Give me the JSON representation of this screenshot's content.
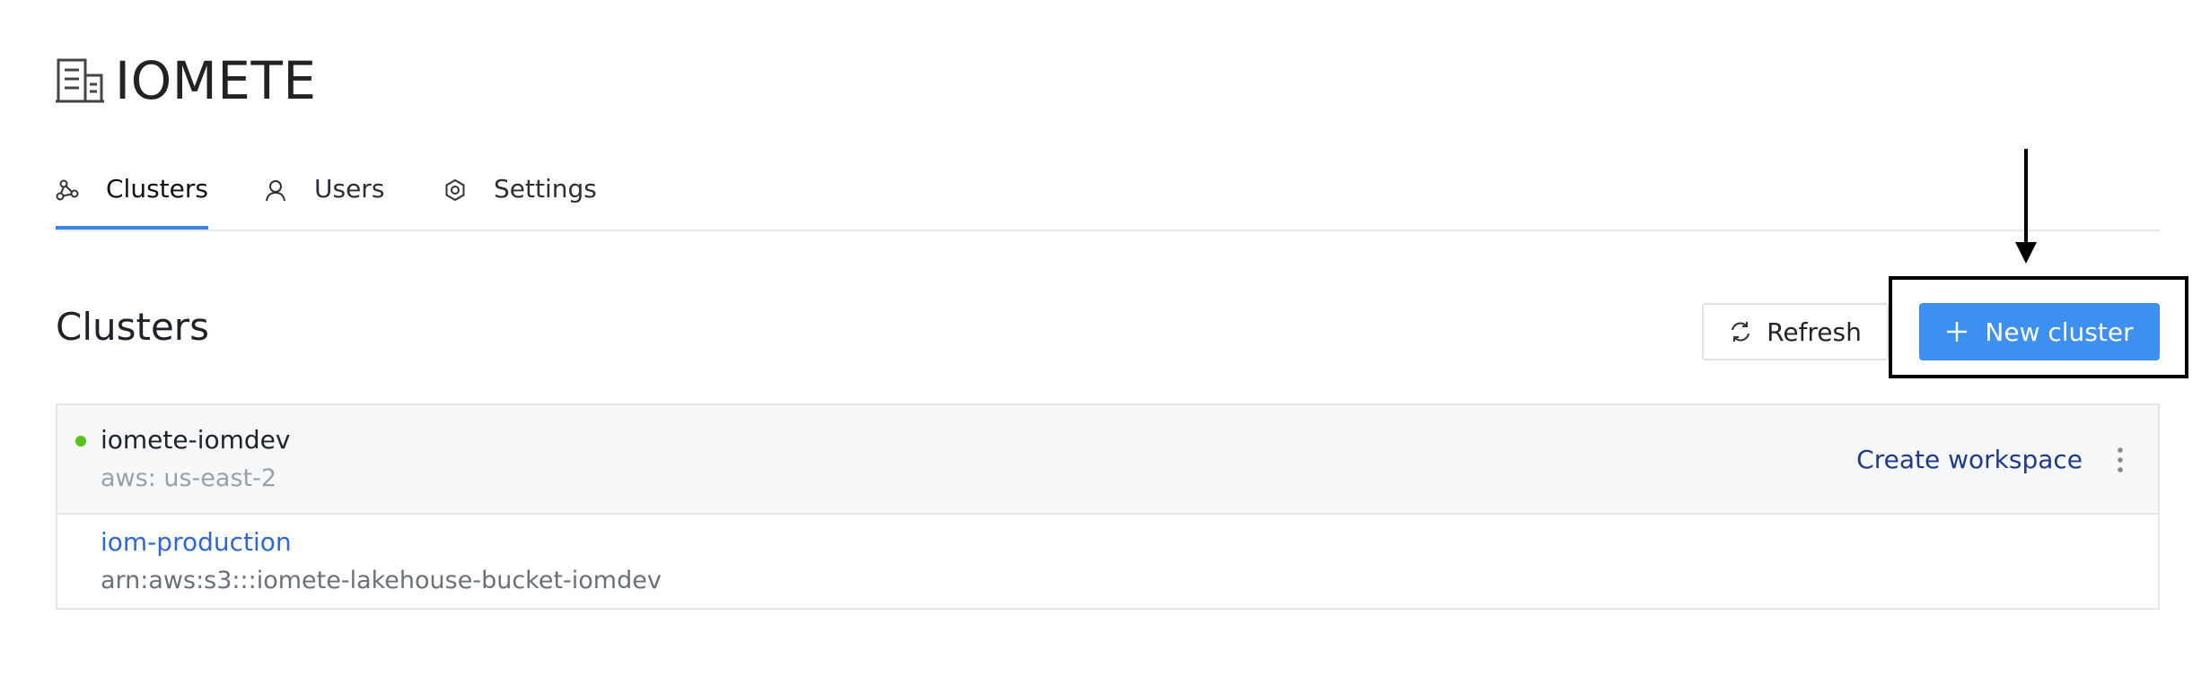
{
  "app": {
    "title": "IOMETE",
    "logo_icon": "building-icon"
  },
  "tabs": [
    {
      "label": "Clusters",
      "icon": "cluster-icon",
      "active": true
    },
    {
      "label": "Users",
      "icon": "user-icon",
      "active": false
    },
    {
      "label": "Settings",
      "icon": "gear-icon",
      "active": false
    }
  ],
  "main": {
    "section_title": "Clusters",
    "refresh_label": "Refresh",
    "new_cluster_label": "New cluster"
  },
  "clusters": [
    {
      "name": "iomete-iomdev",
      "region": "aws: us-east-2",
      "status_color": "#52c41a",
      "action_label": "Create workspace",
      "workspaces": [
        {
          "name": "iom-production",
          "bucket": "arn:aws:s3:::iomete-lakehouse-bucket-iomdev"
        }
      ]
    }
  ],
  "colors": {
    "accent": "#3d8ff0",
    "link": "#2f67d6",
    "status_ok": "#52c41a"
  }
}
